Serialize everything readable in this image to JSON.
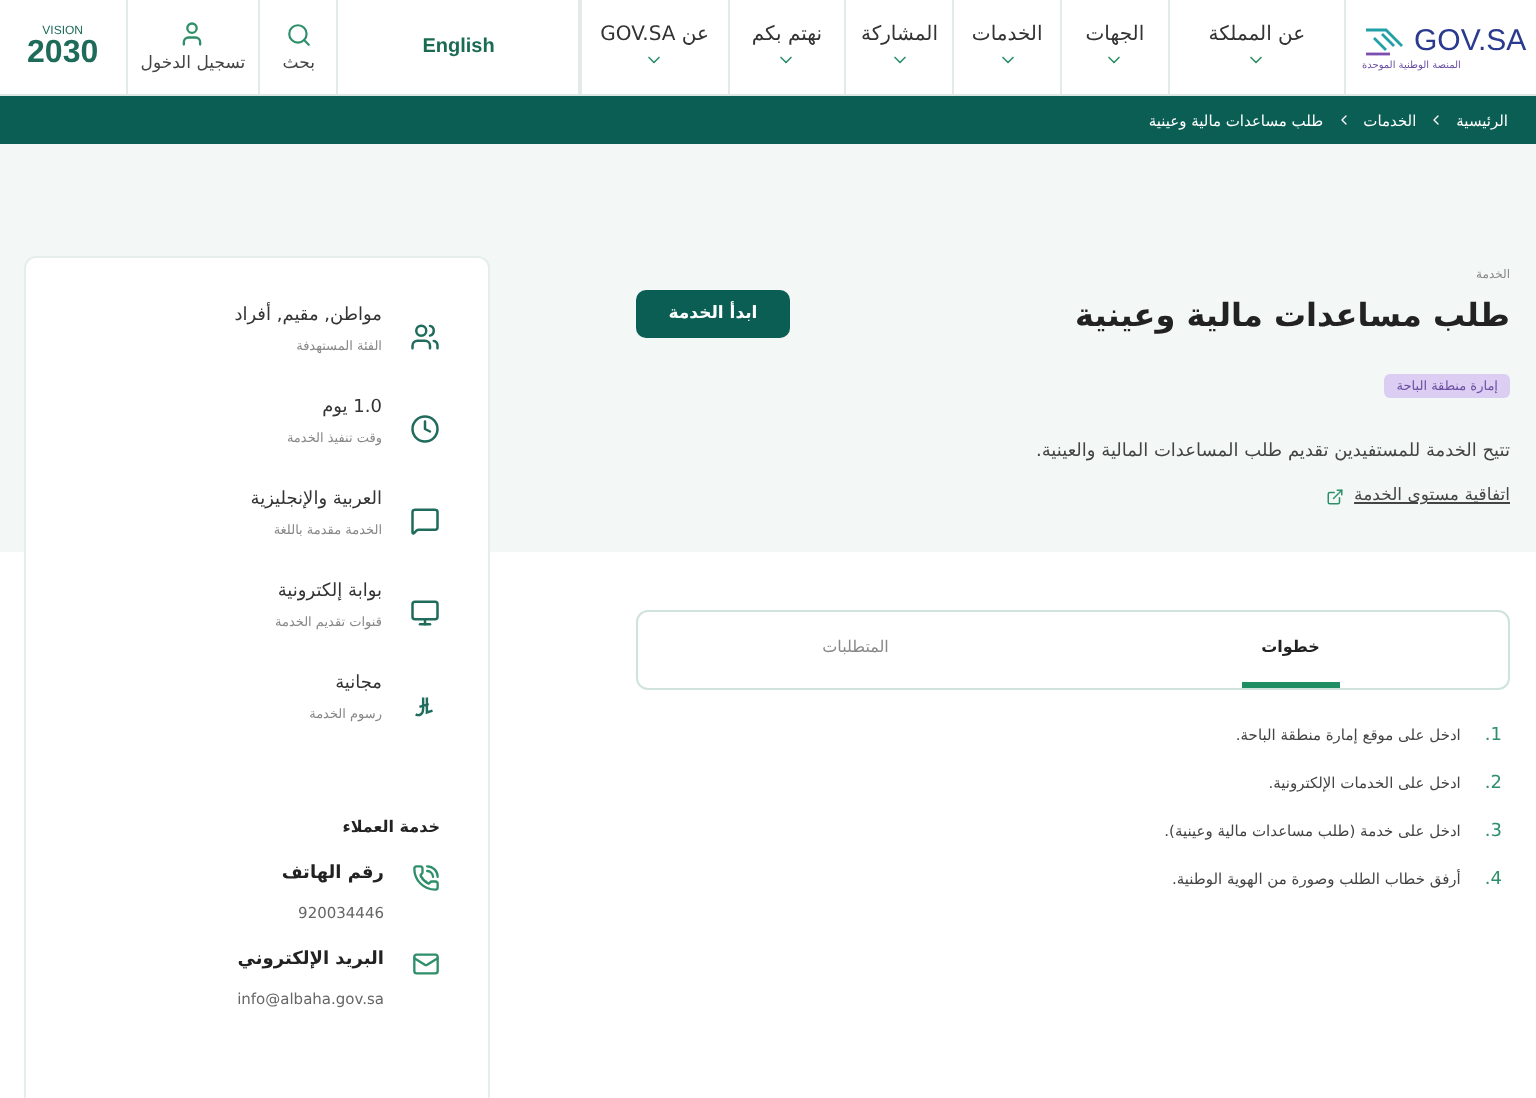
{
  "header": {
    "logo": {
      "name": "GOV.SA",
      "subtitle": "المنصة الوطنية الموحدة"
    },
    "nav": [
      {
        "label": "عن المملكة"
      },
      {
        "label": "الجهات"
      },
      {
        "label": "الخدمات"
      },
      {
        "label": "المشاركة"
      },
      {
        "label": "نهتم بكم"
      },
      {
        "label": "عن GOV.SA"
      }
    ],
    "language": "English",
    "search": "بحث",
    "login": "تسجيل الدخول",
    "vision": {
      "top": "VISION",
      "number": "2030"
    }
  },
  "breadcrumb": [
    "الرئيسية",
    "الخدمات",
    "طلب مساعدات مالية وعينية"
  ],
  "service": {
    "eyebrow": "الخدمة",
    "title": "طلب مساعدات مالية وعينية",
    "start_button": "ابدأ الخدمة",
    "agency_tag": "إمارة منطقة الباحة",
    "description": "تتيح الخدمة للمستفيدين تقديم طلب المساعدات المالية والعينية.",
    "sla_link": "اتفاقية مستوى الخدمة"
  },
  "tabs": [
    {
      "label": "خطوات",
      "selected": true
    },
    {
      "label": "المتطلبات",
      "selected": false
    }
  ],
  "steps": [
    {
      "number": "1.",
      "text": "ادخل على موقع إمارة منطقة الباحة."
    },
    {
      "number": "2.",
      "text": "ادخل على الخدمات الإلكترونية."
    },
    {
      "number": "3.",
      "text": "ادخل على خدمة (طلب مساعدات مالية وعينية)."
    },
    {
      "number": "4.",
      "text": "أرفق خطاب الطلب وصورة من الهوية الوطنية."
    }
  ],
  "sidebar": {
    "facts": [
      {
        "kind": "audience",
        "value": "مواطن, مقيم, أفراد",
        "label": "الفئة المستهدفة"
      },
      {
        "kind": "time",
        "value": "1.0 يوم",
        "label": "وقت تنفيذ الخدمة"
      },
      {
        "kind": "language",
        "value": "العربية والإنجليزية",
        "label": "الخدمة مقدمة باللغة"
      },
      {
        "kind": "channel",
        "value": "بوابة إلكترونية",
        "label": "قنوات تقديم الخدمة"
      },
      {
        "kind": "fee",
        "value": "مجانية",
        "label": "رسوم الخدمة"
      }
    ],
    "support_title": "خدمة العملاء",
    "contacts": [
      {
        "kind": "phone",
        "label": "رقم الهاتف",
        "value": "920034446"
      },
      {
        "kind": "email",
        "label": "البريد الإلكتروني",
        "value": "info@albaha.gov.sa"
      }
    ]
  }
}
